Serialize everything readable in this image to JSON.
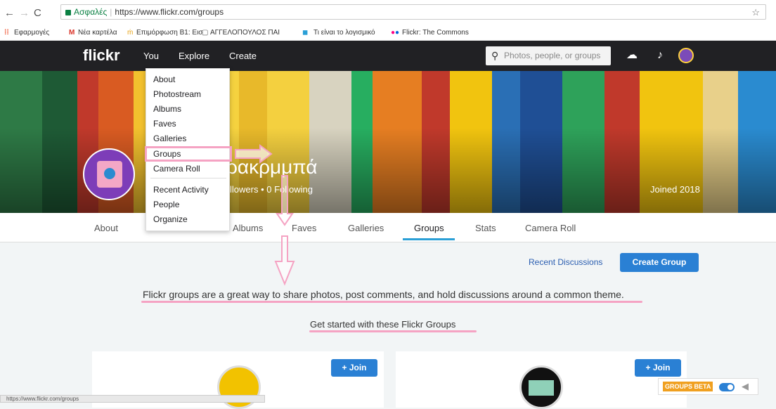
{
  "browser": {
    "secure_label": "Ασφαλές",
    "url": "https://www.flickr.com/groups",
    "bookmarks": [
      "Εφαρμογές",
      "Νέα καρτέλα",
      "Επιμόρφωση B1: Εισ",
      "ΑΓΓΕΛΟΠΟΥΛΟΣ ΠΑΙ",
      "Τι είναι το λογισμικό",
      "Flickr: The Commons"
    ],
    "status_url": "https://www.flickr.com/groups"
  },
  "topnav": {
    "logo": "flickr",
    "you": "You",
    "explore": "Explore",
    "create": "Create",
    "search_placeholder": "Photos, people, or groups"
  },
  "you_menu": {
    "items": [
      "About",
      "Photostream",
      "Albums",
      "Faves",
      "Galleries",
      "Groups",
      "Camera Roll",
      "Recent Activity",
      "People",
      "Organize"
    ],
    "selected": "Groups"
  },
  "profile": {
    "name_fragment": "ρακρμμπά",
    "follow_text": "llowers  •  0 Following",
    "joined": "Joined 2018"
  },
  "subnav": {
    "tabs": [
      "About",
      "Albums",
      "Faves",
      "Galleries",
      "Groups",
      "Stats",
      "Camera Roll"
    ],
    "active": "Groups"
  },
  "groups_page": {
    "recent_discussions": "Recent Discussions",
    "create_group": "Create Group",
    "intro": "Flickr groups are a great way to share photos, post comments, and hold discussions around a common theme.",
    "get_started": "Get started with these Flickr Groups",
    "join_label": "+ Join"
  },
  "beta_widget": {
    "label": "GROUPS BETA"
  },
  "colors": {
    "accent_blue": "#2a80d4",
    "annotation_pink": "#f5a3c3",
    "nav_dark": "#212124"
  },
  "icons": [
    "back-arrow-icon",
    "forward-arrow-icon",
    "reload-icon",
    "lock-icon",
    "star-icon",
    "search-icon",
    "upload-cloud-icon",
    "bell-icon",
    "megaphone-icon"
  ]
}
